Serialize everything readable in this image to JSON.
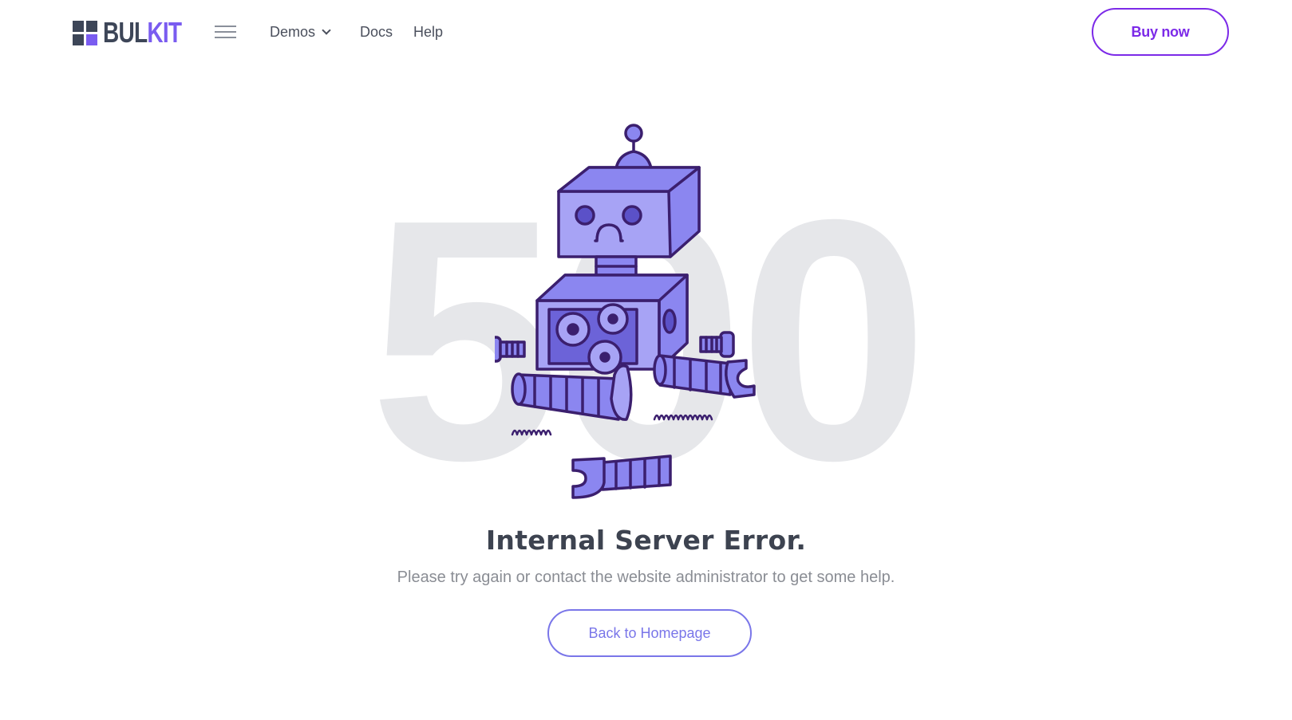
{
  "header": {
    "logo": {
      "part1": "BUL",
      "part2": "KIT"
    },
    "nav": {
      "demos_label": "Demos",
      "docs_label": "Docs",
      "help_label": "Help"
    },
    "buy_label": "Buy now"
  },
  "hero": {
    "code": "500",
    "title": "Internal Server Error.",
    "subtitle": "Please try again or contact the website administrator to get some help.",
    "home_button_label": "Back to Homepage"
  },
  "colors": {
    "brand_purple": "#7c2ae8",
    "robot_fill": "#8b86f0",
    "robot_outline": "#3b1f6e",
    "muted_text": "#8a8d94",
    "background_code": "#e6e7ea"
  },
  "icons": [
    "hamburger-icon",
    "chevron-down-icon",
    "broken-robot-illustration"
  ]
}
